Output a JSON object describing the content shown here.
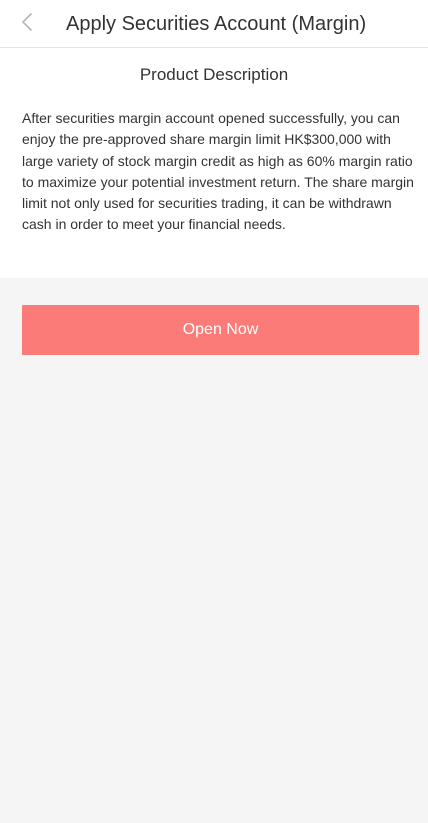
{
  "header": {
    "title": "Apply Securities Account (Margin)",
    "back_icon": "chevron-left-icon"
  },
  "product": {
    "section_title": "Product Description",
    "description": "After securities margin account opened successfully, you can enjoy the pre-approved share margin limit HK$300,000 with large variety of stock margin credit as high as 60% margin ratio to maximize your potential investment return. The share margin limit not only used for securities trading, it can be withdrawn cash in order to meet your financial needs."
  },
  "actions": {
    "open_now_label": "Open Now"
  },
  "colors": {
    "accent": "#fb7b78",
    "background": "#f5f5f5",
    "text": "#333333"
  }
}
